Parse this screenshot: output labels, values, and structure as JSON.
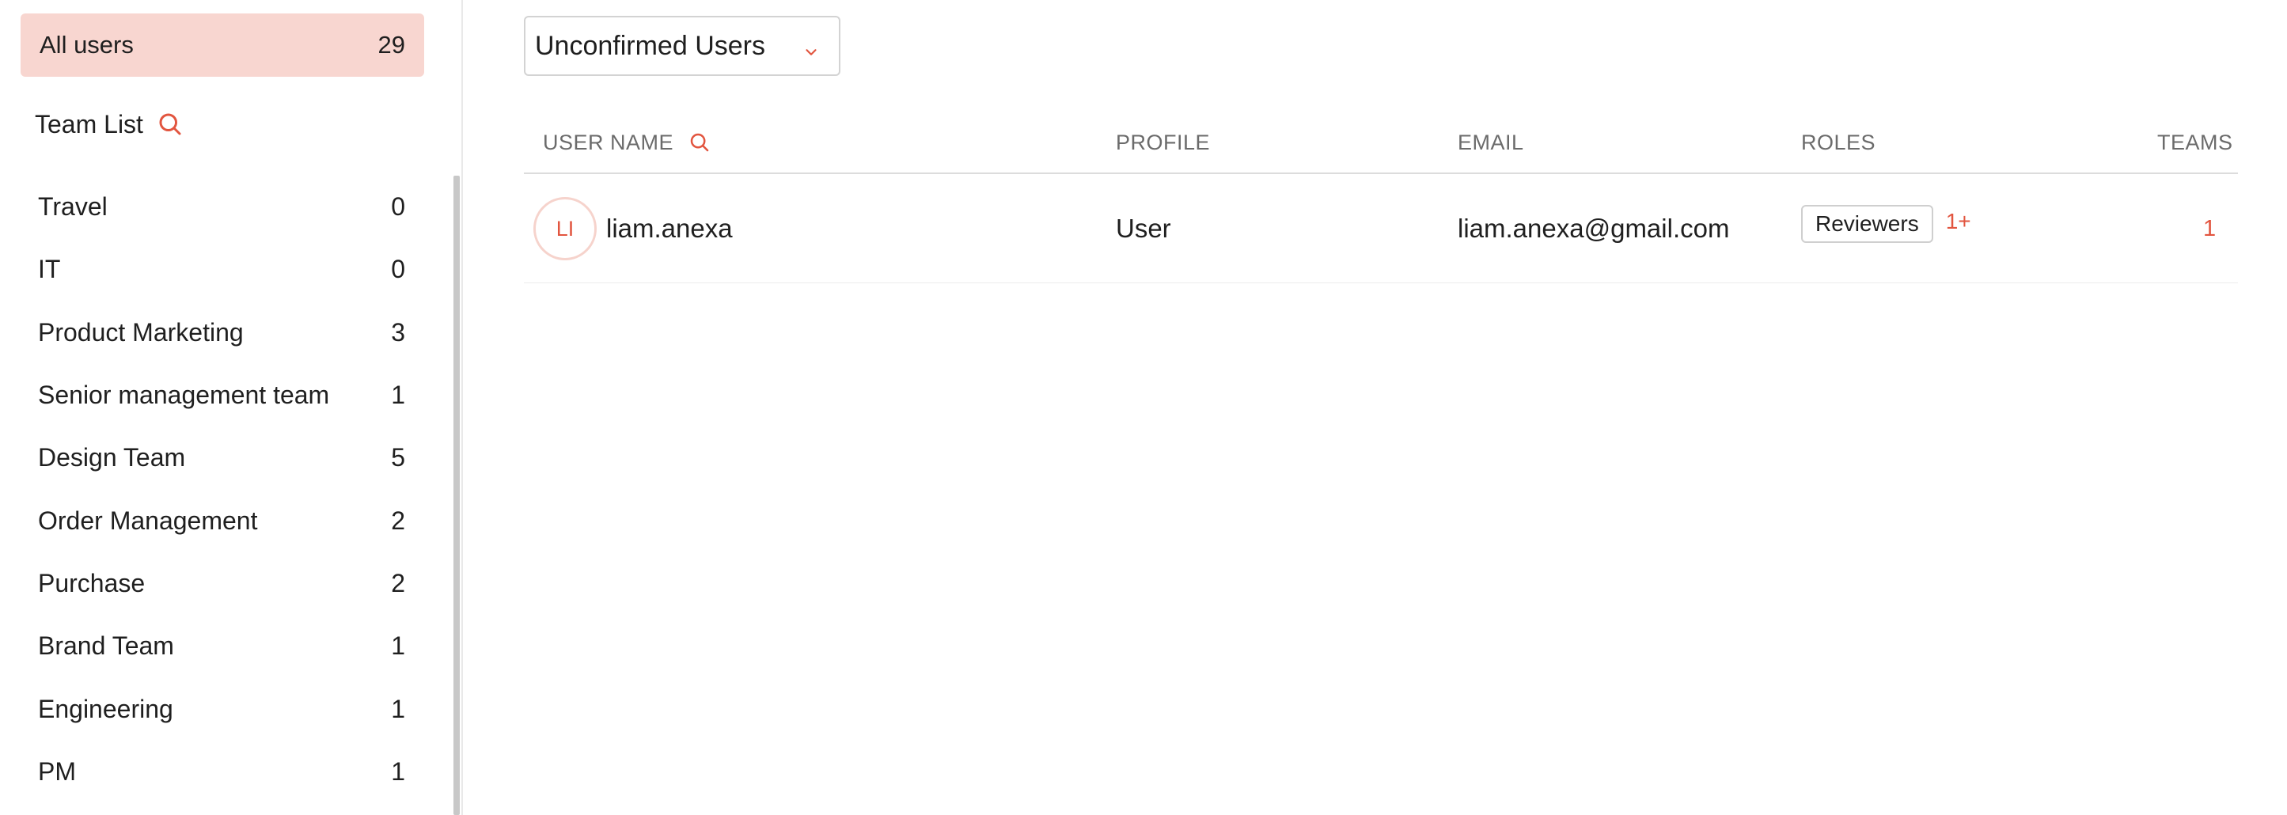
{
  "sidebar": {
    "all_users": {
      "label": "All users",
      "count": "29"
    },
    "team_list_title": "Team List",
    "teams": [
      {
        "name": "Travel",
        "count": "0"
      },
      {
        "name": "IT",
        "count": "0"
      },
      {
        "name": "Product Marketing",
        "count": "3"
      },
      {
        "name": "Senior management team",
        "count": "1"
      },
      {
        "name": "Design Team",
        "count": "5"
      },
      {
        "name": "Order Management",
        "count": "2"
      },
      {
        "name": "Purchase",
        "count": "2"
      },
      {
        "name": "Brand Team",
        "count": "1"
      },
      {
        "name": "Engineering",
        "count": "1"
      },
      {
        "name": "PM",
        "count": "1"
      }
    ]
  },
  "filter": {
    "selected": "Unconfirmed Users"
  },
  "table": {
    "headers": {
      "user_name": "USER NAME",
      "profile": "PROFILE",
      "email": "EMAIL",
      "roles": "ROLES",
      "teams": "TEAMS"
    },
    "rows": [
      {
        "initials": "LI",
        "user_name": "liam.anexa",
        "profile": "User",
        "email": "liam.anexa@gmail.com",
        "role": "Reviewers",
        "role_more": "1+",
        "teams": "1"
      }
    ]
  },
  "colors": {
    "accent": "#e2553f",
    "selected_bg": "#f8d6d0"
  },
  "icons": {
    "team_search": "search-icon",
    "username_search": "search-icon",
    "filter_dropdown": "chevron-down-icon"
  }
}
